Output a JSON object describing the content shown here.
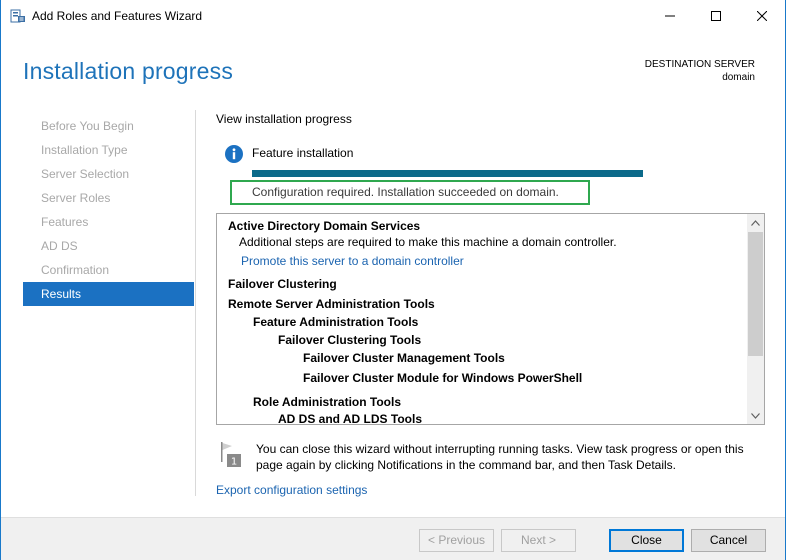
{
  "window": {
    "title": "Add Roles and Features Wizard",
    "icon": "server-manager-icon"
  },
  "header": {
    "title": "Installation progress",
    "destination_label": "DESTINATION SERVER",
    "destination_server": "domain"
  },
  "nav": {
    "items": [
      {
        "label": "Before You Begin",
        "active": false
      },
      {
        "label": "Installation Type",
        "active": false
      },
      {
        "label": "Server Selection",
        "active": false
      },
      {
        "label": "Server Roles",
        "active": false
      },
      {
        "label": "Features",
        "active": false
      },
      {
        "label": "AD DS",
        "active": false
      },
      {
        "label": "Confirmation",
        "active": false
      },
      {
        "label": "Results",
        "active": true
      }
    ]
  },
  "main": {
    "heading": "View installation progress",
    "feature_label": "Feature installation",
    "progress_fraction": 1.0,
    "status_text": "Configuration required. Installation succeeded on domain.",
    "results": [
      {
        "text": "Active Directory Domain Services",
        "style": "bold",
        "indent": 0
      },
      {
        "text": "Additional steps are required to make this machine a domain controller.",
        "style": "normal",
        "indent": 1
      },
      {
        "text": "Promote this server to a domain controller",
        "style": "link",
        "indent": 1
      },
      {
        "text": "Failover Clustering",
        "style": "bold",
        "indent": 0
      },
      {
        "text": "Remote Server Administration Tools",
        "style": "bold",
        "indent": 0
      },
      {
        "text": "Feature Administration Tools",
        "style": "bold",
        "indent": 1
      },
      {
        "text": "Failover Clustering Tools",
        "style": "bold",
        "indent": 2
      },
      {
        "text": "Failover Cluster Management Tools",
        "style": "bold",
        "indent": 3
      },
      {
        "text": "Failover Cluster Module for Windows PowerShell",
        "style": "bold",
        "indent": 3
      },
      {
        "text": "Role Administration Tools",
        "style": "bold",
        "indent": 1
      },
      {
        "text": "AD DS and AD LDS Tools",
        "style": "bold",
        "indent": 2
      }
    ],
    "notice_icon_number": "1",
    "notice_text": "You can close this wizard without interrupting running tasks. View task progress or open this page again by clicking Notifications in the command bar, and then Task Details.",
    "export_link": "Export configuration settings"
  },
  "footer": {
    "previous_label": "< Previous",
    "next_label": "Next >",
    "close_label": "Close",
    "cancel_label": "Cancel"
  },
  "colors": {
    "accent": "#1b71c2",
    "title_blue": "#1e73b9",
    "progress": "#0b6a8a",
    "highlight_box": "#2fa84f",
    "link": "#1b64b0"
  }
}
